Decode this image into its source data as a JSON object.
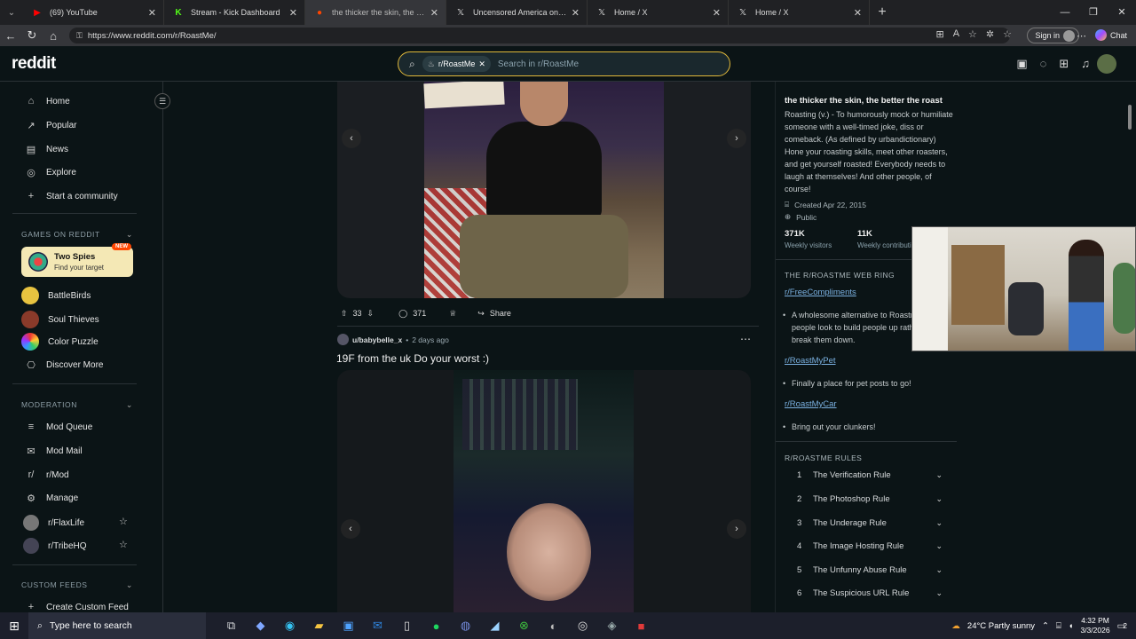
{
  "browser": {
    "tabs": [
      {
        "icon": "youtube-icon",
        "label": "(69) YouTube",
        "color": "#ff0000"
      },
      {
        "icon": "kick-icon",
        "label": "Stream - Kick Dashboard",
        "color": "#53fc18"
      },
      {
        "icon": "reddit-icon",
        "label": "the thicker the skin, the better the",
        "color": "#ff4500",
        "active": true
      },
      {
        "icon": "x-icon",
        "label": "Uncensored America on X: \"Myron",
        "color": "#ffffff"
      },
      {
        "icon": "x-icon",
        "label": "Home / X",
        "color": "#ffffff"
      },
      {
        "icon": "x-icon",
        "label": "Home / X",
        "color": "#ffffff"
      }
    ],
    "url": "https://www.reddit.com/r/RoastMe/",
    "signin_label": "Sign in",
    "chat_label": "Chat"
  },
  "header": {
    "logo": "reddit",
    "search_chip": "r/RoastMe",
    "search_placeholder": "Search in r/RoastMe"
  },
  "left_nav": {
    "items": [
      {
        "icon": "home-icon",
        "label": "Home"
      },
      {
        "icon": "popular-icon",
        "label": "Popular"
      },
      {
        "icon": "news-icon",
        "label": "News"
      },
      {
        "icon": "explore-icon",
        "label": "Explore"
      },
      {
        "icon": "plus-icon",
        "label": "Start a community"
      }
    ],
    "games_heading": "GAMES ON REDDIT",
    "featured_game": {
      "title": "Two Spies",
      "subtitle": "Find your target",
      "badge": "NEW"
    },
    "games": [
      {
        "label": "BattleBirds",
        "color": "#e8c340"
      },
      {
        "label": "Soul Thieves",
        "color": "#8a3a2a"
      },
      {
        "label": "Color Puzzle",
        "color": "#ffffff"
      },
      {
        "label": "Discover More",
        "color": ""
      }
    ],
    "moderation_heading": "MODERATION",
    "moderation": [
      {
        "icon": "mod-queue-icon",
        "label": "Mod Queue"
      },
      {
        "icon": "mod-mail-icon",
        "label": "Mod Mail"
      },
      {
        "icon": "subreddit-icon",
        "label": "r/Mod"
      },
      {
        "icon": "settings-icon",
        "label": "Manage"
      }
    ],
    "communities": [
      {
        "label": "r/FlaxLife"
      },
      {
        "label": "r/TribeHQ"
      }
    ],
    "custom_feeds_heading": "CUSTOM FEEDS",
    "create_feed_label": "Create Custom Feed"
  },
  "feed": {
    "post1": {
      "upvotes": "33",
      "comments": "371",
      "share_label": "Share"
    },
    "post2": {
      "user": "u/babybelle_x",
      "time": "2 days ago",
      "title": "19F from the uk Do your worst :)"
    }
  },
  "right_sidebar": {
    "title": "the thicker the skin, the better the roast",
    "description": "Roasting (v.) - To humorously mock or humiliate someone with a well-timed joke, diss or comeback. (As defined by urbandictionary) Hone your roasting skills, meet other roasters, and get yourself roasted! Everybody needs to laugh at themselves! And other people, of course!",
    "created": "Created Apr 22, 2015",
    "visibility": "Public",
    "stats": [
      {
        "value": "371K",
        "label": "Weekly visitors"
      },
      {
        "value": "11K",
        "label": "Weekly contributions"
      }
    ],
    "webring_heading": "THE R/ROASTME WEB RING",
    "webring": [
      {
        "link": "r/FreeCompliments",
        "desc": "A wholesome alternative to Roastme where people look to build people up rather than break them down."
      },
      {
        "link": "r/RoastMyPet",
        "desc": "Finally a place for pet posts to go!"
      },
      {
        "link": "r/RoastMyCar",
        "desc": "Bring out your clunkers!"
      }
    ],
    "rules_heading": "R/ROASTME RULES",
    "rules": [
      {
        "num": "1",
        "label": "The Verification Rule"
      },
      {
        "num": "2",
        "label": "The Photoshop Rule"
      },
      {
        "num": "3",
        "label": "The Underage Rule"
      },
      {
        "num": "4",
        "label": "The Image Hosting Rule"
      },
      {
        "num": "5",
        "label": "The Unfunny Abuse Rule"
      },
      {
        "num": "6",
        "label": "The Suspicious URL Rule"
      }
    ]
  },
  "taskbar": {
    "search_placeholder": "Type here to search",
    "weather": "24°C  Partly sunny",
    "time": "4:32 PM",
    "date": "3/3/2026",
    "notifications": "2"
  }
}
